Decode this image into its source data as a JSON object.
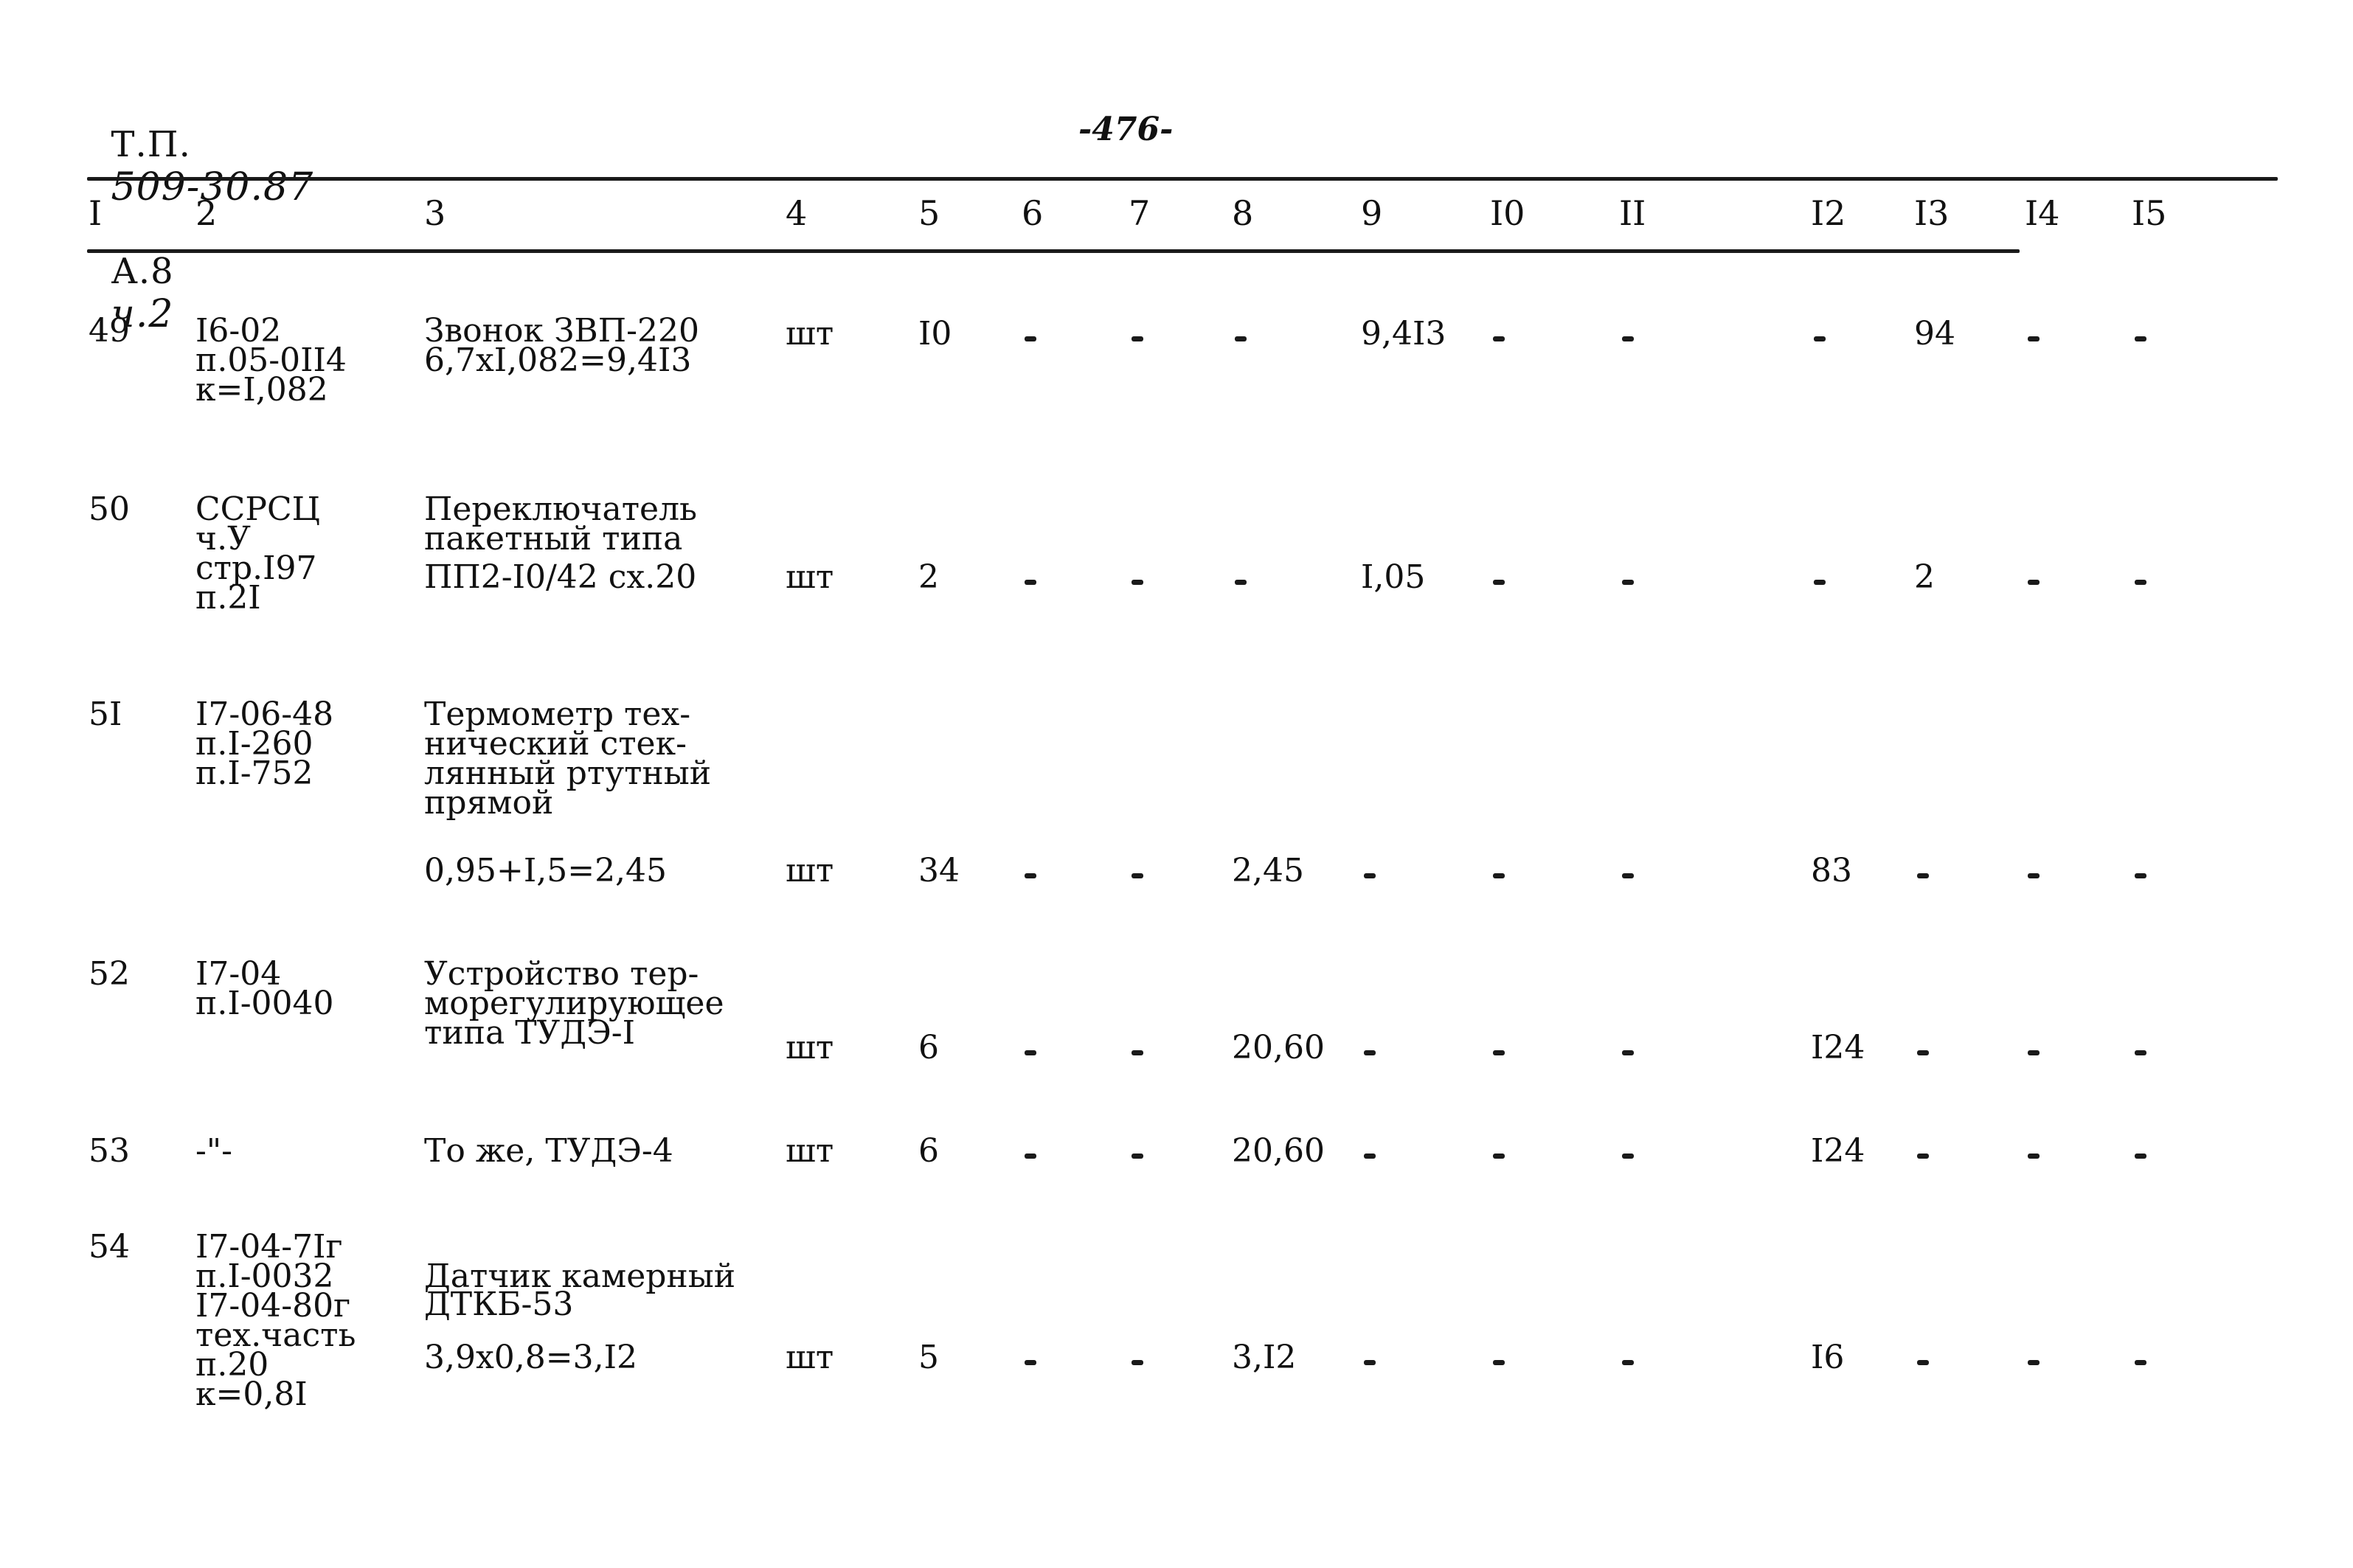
{
  "header": {
    "doc_prefix": "Т.П.",
    "doc_number": "509-30.87",
    "album": "А.8",
    "part": "ч.2",
    "page_number": "-476-"
  },
  "columns": [
    "I",
    "2",
    "3",
    "4",
    "5",
    "6",
    "7",
    "8",
    "9",
    "I0",
    "II",
    "I2",
    "I3",
    "I4",
    "I5"
  ],
  "rows": [
    {
      "no": "49",
      "ref": [
        "I6-02",
        "п.05-0II4",
        "к=I,082"
      ],
      "desc": [
        "Звонок ЗВП-220",
        "6,7хI,082=9,4I3"
      ],
      "unit": "шт",
      "c5": "I0",
      "c6": "-",
      "c7": "-",
      "c8": "-",
      "c9": "9,4I3",
      "c10": "-",
      "c11": "-",
      "c12": "-",
      "c13": "94",
      "c14": "-",
      "c15": "-"
    },
    {
      "no": "50",
      "ref": [
        "ССРСЦ",
        "ч.У",
        "стр.I97",
        "п.2I"
      ],
      "desc": [
        "Переключатель",
        "пакетный типа",
        "ПП2-I0/42 сх.20"
      ],
      "unit": "шт",
      "c5": "2",
      "c6": "-",
      "c7": "-",
      "c8": "-",
      "c9": "I,05",
      "c10": "-",
      "c11": "-",
      "c12": "-",
      "c13": "2",
      "c14": "-",
      "c15": "-"
    },
    {
      "no": "5I",
      "ref": [
        "I7-06-48",
        "п.I-260",
        "п.I-752"
      ],
      "desc": [
        "Термометр тех-",
        "нический стек-",
        "лянный ртутный",
        "прямой",
        "0,95+I,5=2,45"
      ],
      "unit": "шт",
      "c5": "34",
      "c6": "-",
      "c7": "-",
      "c8": "2,45",
      "c9": "-",
      "c10": "-",
      "c11": "-",
      "c12": "83",
      "c13": "-",
      "c14": "-",
      "c15": "-"
    },
    {
      "no": "52",
      "ref": [
        "I7-04",
        "п.I-0040"
      ],
      "desc": [
        "Устройство тер-",
        "морегулирующее",
        "типа ТУДЭ-I"
      ],
      "unit": "шт",
      "c5": "6",
      "c6": "-",
      "c7": "-",
      "c8": "20,60",
      "c9": "-",
      "c10": "-",
      "c11": "-",
      "c12": "I24",
      "c13": "-",
      "c14": "-",
      "c15": "-"
    },
    {
      "no": "53",
      "ref": [
        "-\"-"
      ],
      "desc": [
        "То же, ТУДЭ-4"
      ],
      "unit": "шт",
      "c5": "6",
      "c6": "-",
      "c7": "-",
      "c8": "20,60",
      "c9": "-",
      "c10": "-",
      "c11": "-",
      "c12": "I24",
      "c13": "-",
      "c14": "-",
      "c15": "-"
    },
    {
      "no": "54",
      "ref": [
        "I7-04-7Iг",
        "п.I-0032",
        "I7-04-80г",
        "тех.часть",
        "п.20",
        "к=0,8I"
      ],
      "desc": [
        "Датчик камерный",
        "ДТКБ-53",
        "3,9х0,8=3,I2"
      ],
      "unit": "шт",
      "c5": "5",
      "c6": "-",
      "c7": "-",
      "c8": "3,I2",
      "c9": "-",
      "c10": "-",
      "c11": "-",
      "c12": "I6",
      "c13": "-",
      "c14": "-",
      "c15": "-"
    }
  ]
}
